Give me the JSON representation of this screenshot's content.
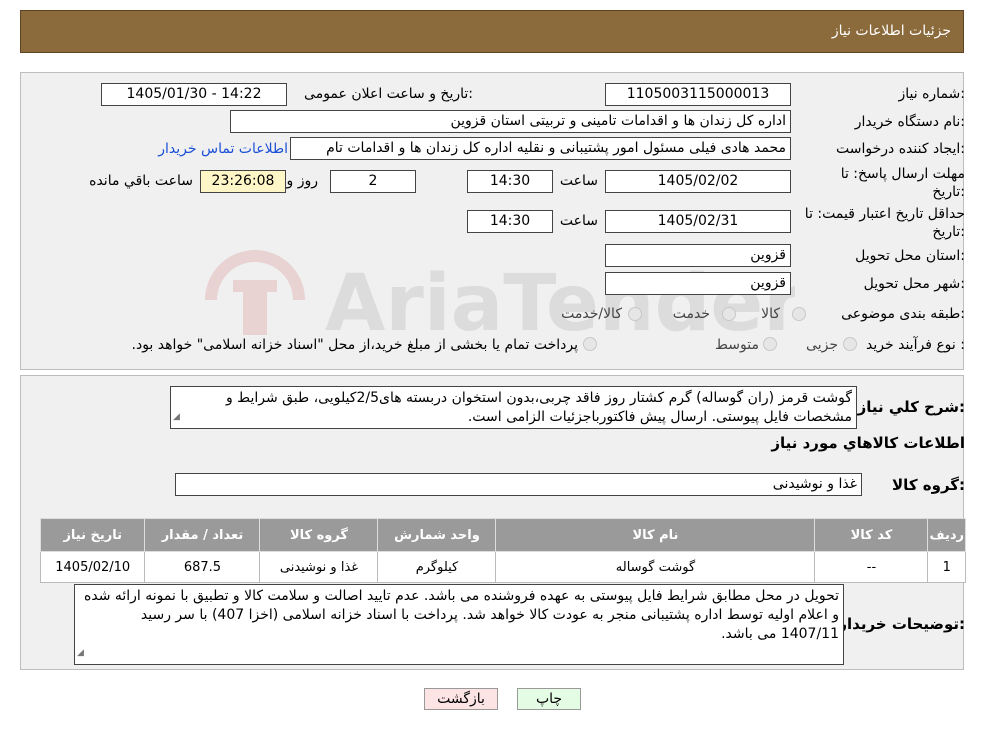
{
  "header": {
    "title": "جزئیات اطلاعات نیاز"
  },
  "form": {
    "need_number_label": "شماره نیاز:",
    "need_number": "1105003115000013",
    "announce_label": "تاریخ و ساعت اعلان عمومی:",
    "announce_value": "1405/01/30 - 14:22",
    "buyer_label": "نام دستگاه خریدار:",
    "buyer_value": "اداره کل زندان ها و اقدامات تامینی و تربیتی استان قزوین",
    "creator_label": "ایجاد کننده درخواست:",
    "creator_value": "محمد هادی فیلی مسئول امور پشتیبانی و نقلیه اداره کل زندان ها و اقدامات تام",
    "contact_link": "اطلاعات تماس خریدار",
    "deadline_label_1": "مهلت ارسال پاسخ: تا",
    "deadline_label_2": "تاریخ:",
    "deadline_date": "1405/02/02",
    "time_label": "ساعت",
    "deadline_time": "14:30",
    "days_value": "2",
    "days_label": "روز و",
    "remaining_value": "23:26:08",
    "remaining_label": "ساعت باقي مانده",
    "validity_label_1": "حداقل تاریخ اعتبار قیمت: تا",
    "validity_label_2": "تاریخ:",
    "validity_date": "1405/02/31",
    "validity_time": "14:30",
    "province_label": "استان محل تحویل:",
    "province_value": "قزوین",
    "city_label": "شهر محل تحویل:",
    "city_value": "قزوین",
    "category_label": "طبقه بندی موضوعی:",
    "category_options": [
      "کالا",
      "خدمت",
      "کالا/خدمت"
    ],
    "process_label": "نوع فرآیند خرید :",
    "process_options": [
      "جزیی",
      "متوسط"
    ],
    "process_note": "پرداخت تمام یا بخشی از مبلغ خرید،از محل \"اسناد خزانه اسلامی\" خواهد بود."
  },
  "description": {
    "label": "شرح کلي نياز:",
    "text": "گوشت قرمز (ران گوساله) گرم کشتار روز فاقد چربی،بدون استخوان دربسته های2/5کیلویی، طبق شرایط و مشخصات فایل پیوستی. ارسال پیش فاکتورباجزئیات الزامی است."
  },
  "goods": {
    "section_title": "اطلاعات کالاهاي مورد نياز",
    "group_label": "گروه کالا:",
    "group_value": "غذا و نوشیدنی",
    "columns": [
      "رديف",
      "کد کالا",
      "نام کالا",
      "واحد شمارش",
      "گروه کالا",
      "تعداد / مقدار",
      "تاريخ نياز"
    ],
    "rows": [
      [
        "1",
        "--",
        "گوشت گوساله",
        "کیلوگرم",
        "غذا و نوشیدنی",
        "687.5",
        "1405/02/10"
      ]
    ]
  },
  "buyer_notes": {
    "label": "توضیحات خریدار:",
    "text": "تحویل در محل مطابق شرایط فایل پیوستی به عهده فروشنده می باشد. عدم تایید اصالت و سلامت کالا و تطبیق با نمونه ارائه شده و اعلام اولیه توسط اداره پشتیبانی منجر به عودت کالا خواهد شد. پرداخت با اسناد خزانه اسلامی (اخزا 407) با سر رسید 1407/11 می باشد."
  },
  "buttons": {
    "print": "چاپ",
    "back": "بازگشت"
  },
  "colors": {
    "header_bg": "#8b6a3c",
    "table_header_bg": "#9a9a9a",
    "remaining_bg": "#fff6c8",
    "back_button_bg": "#fde4e4",
    "print_button_bg": "#e4fbe4",
    "link": "#1a4fd6"
  },
  "watermark": {
    "text": "AriaTender.neT"
  }
}
